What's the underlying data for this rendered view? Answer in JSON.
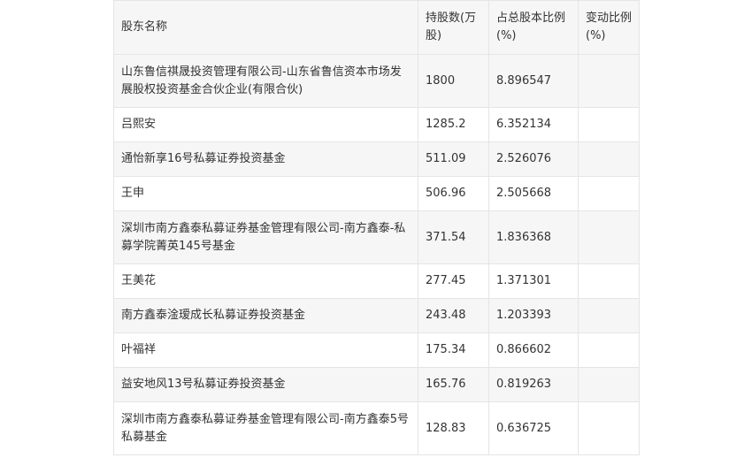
{
  "table": {
    "headers": {
      "name": "股东名称",
      "shares": "持股数(万股)",
      "ratio": "占总股本比例(%)",
      "change": "变动比例(%)"
    },
    "rows": [
      {
        "name": "山东鲁信祺晟投资管理有限公司-山东省鲁信资本市场发展股权投资基金合伙企业(有限合伙)",
        "shares": "1800",
        "ratio": "8.896547",
        "change": ""
      },
      {
        "name": "吕熙安",
        "shares": "1285.2",
        "ratio": "6.352134",
        "change": ""
      },
      {
        "name": "通怡新享16号私募证券投资基金",
        "shares": "511.09",
        "ratio": "2.526076",
        "change": ""
      },
      {
        "name": "王申",
        "shares": "506.96",
        "ratio": "2.505668",
        "change": ""
      },
      {
        "name": "深圳市南方鑫泰私募证券基金管理有限公司-南方鑫泰-私募学院菁英145号基金",
        "shares": "371.54",
        "ratio": "1.836368",
        "change": ""
      },
      {
        "name": "王美花",
        "shares": "277.45",
        "ratio": "1.371301",
        "change": ""
      },
      {
        "name": "南方鑫泰淦瑷成长私募证券投资基金",
        "shares": "243.48",
        "ratio": "1.203393",
        "change": ""
      },
      {
        "name": "叶福祥",
        "shares": "175.34",
        "ratio": "0.866602",
        "change": ""
      },
      {
        "name": "益安地风13号私募证券投资基金",
        "shares": "165.76",
        "ratio": "0.819263",
        "change": ""
      },
      {
        "name": "深圳市南方鑫泰私募证券基金管理有限公司-南方鑫泰5号私募基金",
        "shares": "128.83",
        "ratio": "0.636725",
        "change": ""
      }
    ]
  }
}
